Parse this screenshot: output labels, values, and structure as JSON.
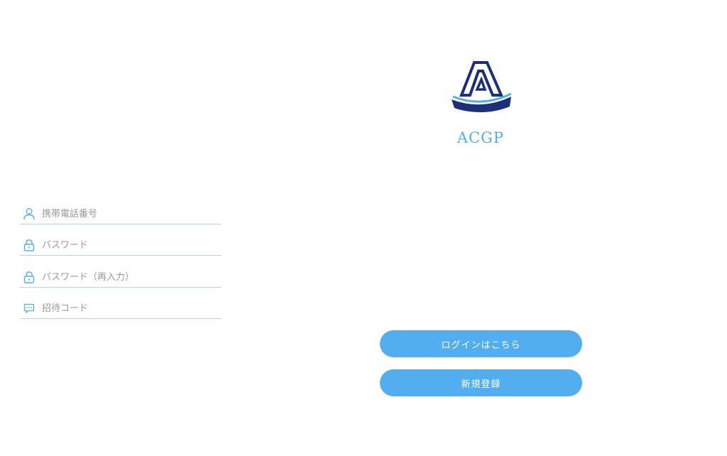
{
  "brand": {
    "name": "ACGP",
    "accent_color": "#52aeee",
    "logo_dark_color": "#1d2f78",
    "logo_icon": "acgp-boat-logo-icon"
  },
  "form": {
    "phone": {
      "icon": "user-icon",
      "placeholder": "携帯電話番号",
      "value": ""
    },
    "password": {
      "icon": "lock-icon",
      "placeholder": "パスワード",
      "value": ""
    },
    "password_confirm": {
      "icon": "lock-icon",
      "placeholder": "パスワード（再入力）",
      "value": ""
    },
    "invite_code": {
      "icon": "message-icon",
      "placeholder": "招待コード",
      "value": ""
    },
    "underline_color": "#a9d6f5"
  },
  "actions": {
    "login_label": "ログインはこちら",
    "register_label": "新規登録",
    "button_color": "#52aeee"
  }
}
